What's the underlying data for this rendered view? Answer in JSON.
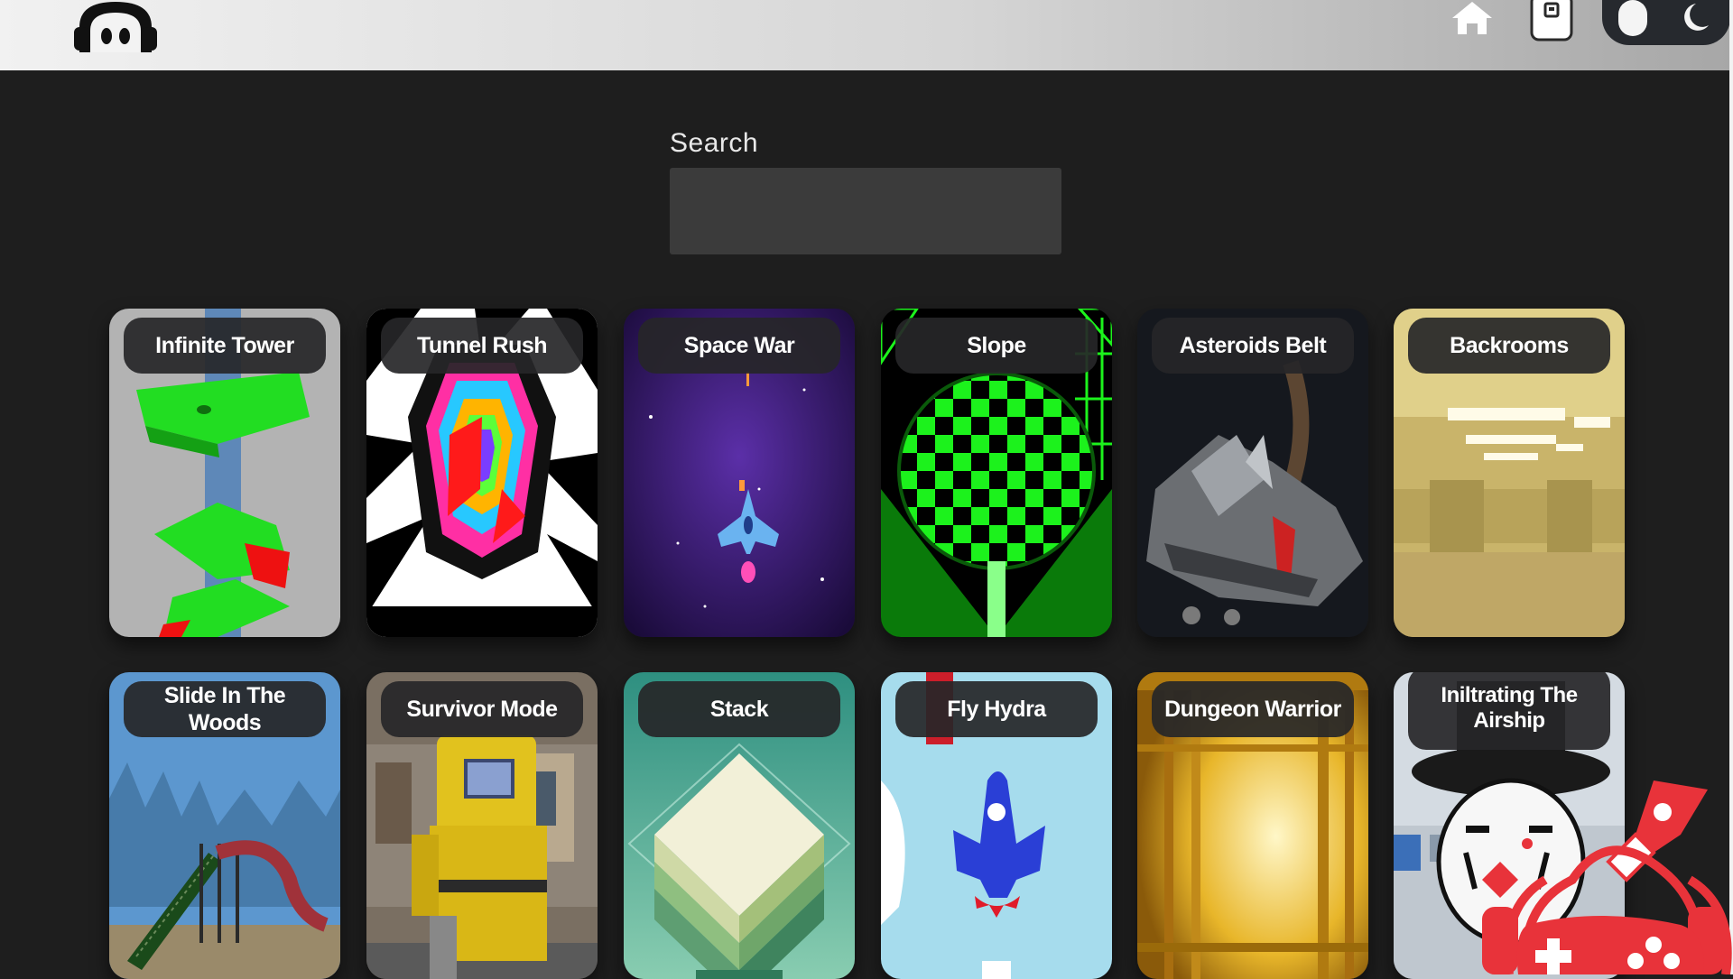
{
  "header": {
    "logo_icon": "ghost-headphones-logo-icon",
    "home_icon": "home-icon",
    "phone_icon": "phone-icon",
    "theme_toggle_icon": "theme-toggle-icon"
  },
  "search": {
    "label": "Search",
    "value": "",
    "placeholder": ""
  },
  "games": [
    {
      "title": "Infinite Tower"
    },
    {
      "title": "Tunnel Rush"
    },
    {
      "title": "Space War"
    },
    {
      "title": "Slope"
    },
    {
      "title": "Asteroids Belt"
    },
    {
      "title": "Backrooms"
    },
    {
      "title": "Slide In The Woods"
    },
    {
      "title": "Survivor Mode"
    },
    {
      "title": "Stack"
    },
    {
      "title": "Fly Hydra"
    },
    {
      "title": "Dungeon Warrior"
    },
    {
      "title": "Iniltrating The Airship"
    }
  ],
  "watermark_icon": "gamepad-rocket-headset-icon",
  "colors": {
    "background": "#1e1e1e",
    "card_label_bg": "#262628",
    "search_bg": "#3b3b3b",
    "watermark_red": "#e8333a"
  }
}
